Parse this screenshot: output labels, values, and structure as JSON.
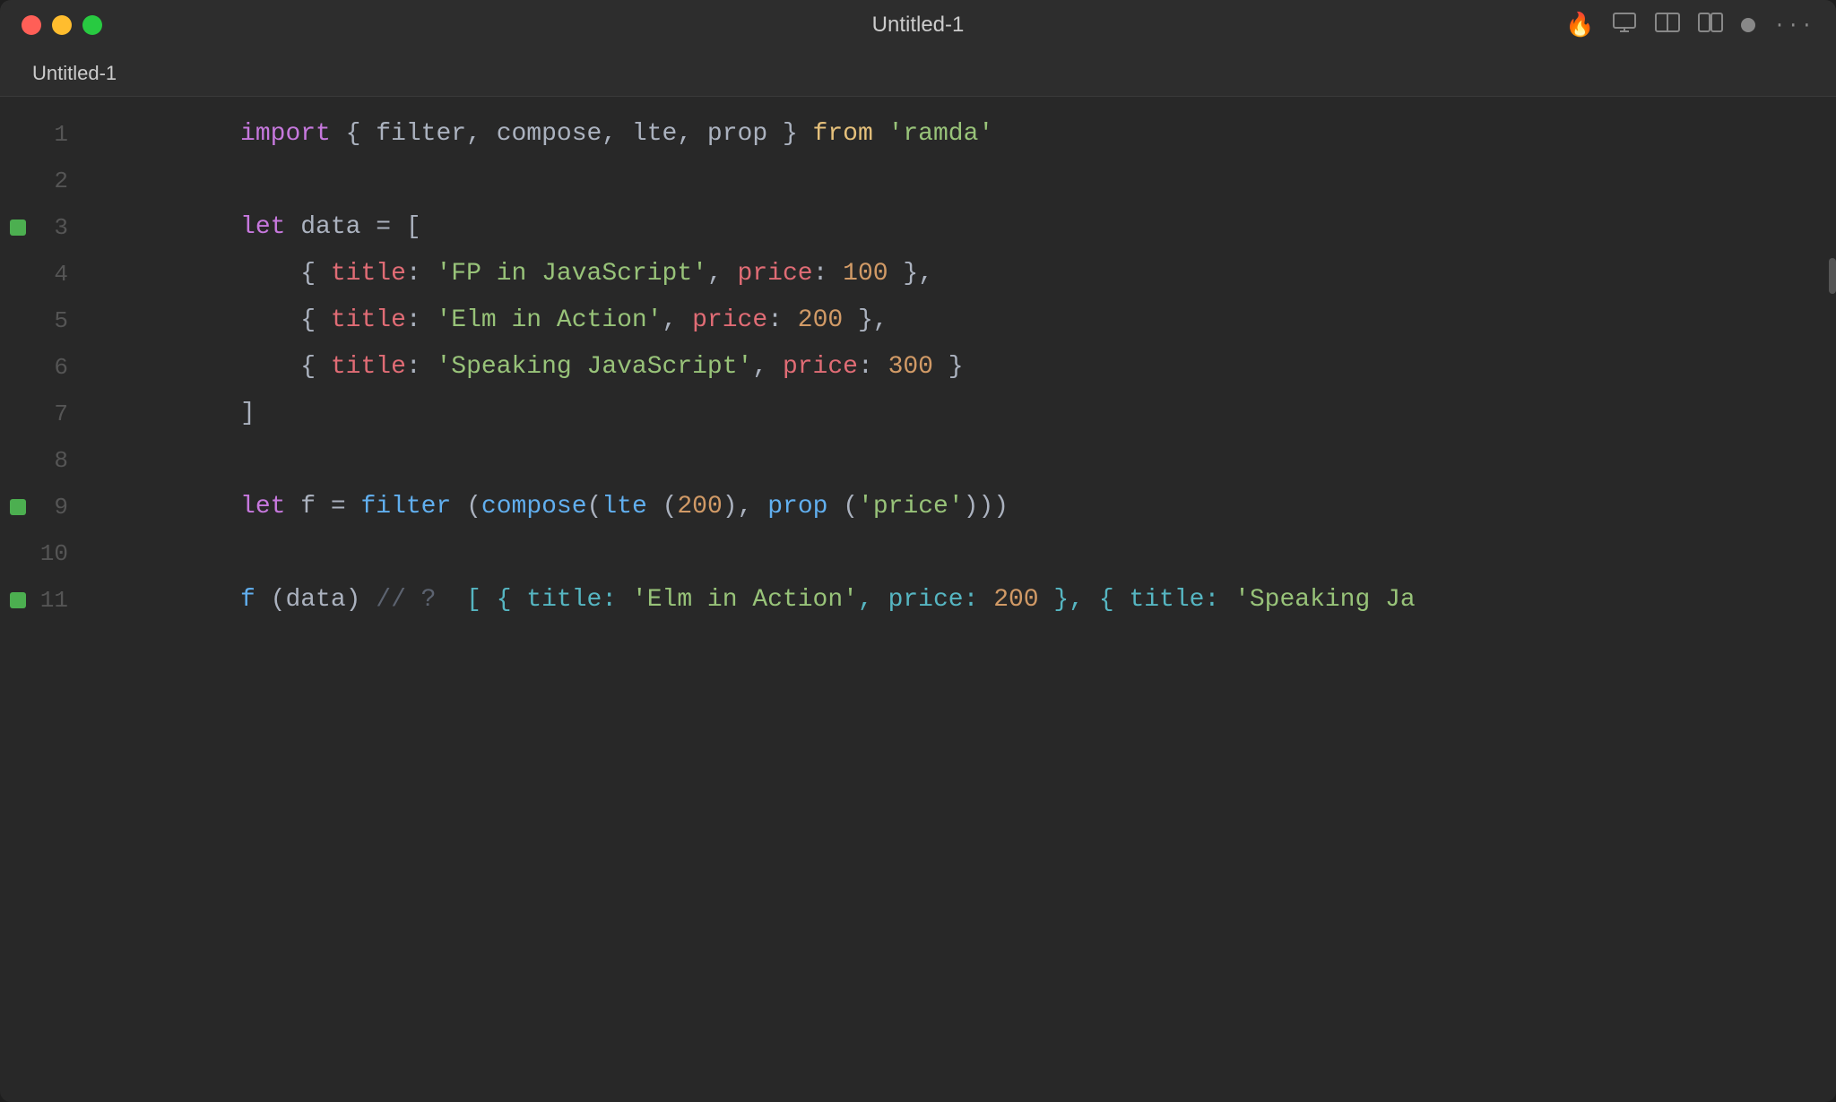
{
  "window": {
    "title": "Untitled-1",
    "tab_label": "Untitled-1"
  },
  "controls": {
    "close": "close",
    "minimize": "minimize",
    "maximize": "maximize"
  },
  "toolbar": {
    "flame_icon": "🔥",
    "icons": [
      "🔥",
      "⬜",
      "⬛",
      "⬜",
      "⚪",
      "···"
    ]
  },
  "code": {
    "lines": [
      {
        "num": 1,
        "has_breakpoint": false,
        "content": "import { filter, compose, lte, prop } from 'ramda'"
      },
      {
        "num": 2,
        "has_breakpoint": false,
        "content": ""
      },
      {
        "num": 3,
        "has_breakpoint": true,
        "content": "let data = ["
      },
      {
        "num": 4,
        "has_breakpoint": false,
        "content": "  { title: 'FP in JavaScript', price: 100 },"
      },
      {
        "num": 5,
        "has_breakpoint": false,
        "content": "  { title: 'Elm in Action', price: 200 },"
      },
      {
        "num": 6,
        "has_breakpoint": false,
        "content": "  { title: 'Speaking JavaScript', price: 300 }"
      },
      {
        "num": 7,
        "has_breakpoint": false,
        "content": "]"
      },
      {
        "num": 8,
        "has_breakpoint": false,
        "content": ""
      },
      {
        "num": 9,
        "has_breakpoint": true,
        "content": "let f = filter (compose(lte (200), prop ('price')))"
      },
      {
        "num": 10,
        "has_breakpoint": false,
        "content": ""
      },
      {
        "num": 11,
        "has_breakpoint": true,
        "content": "f (data) // ? [ { title: 'Elm in Action', price: 200 }, { title: 'Speaking Ja"
      }
    ]
  }
}
